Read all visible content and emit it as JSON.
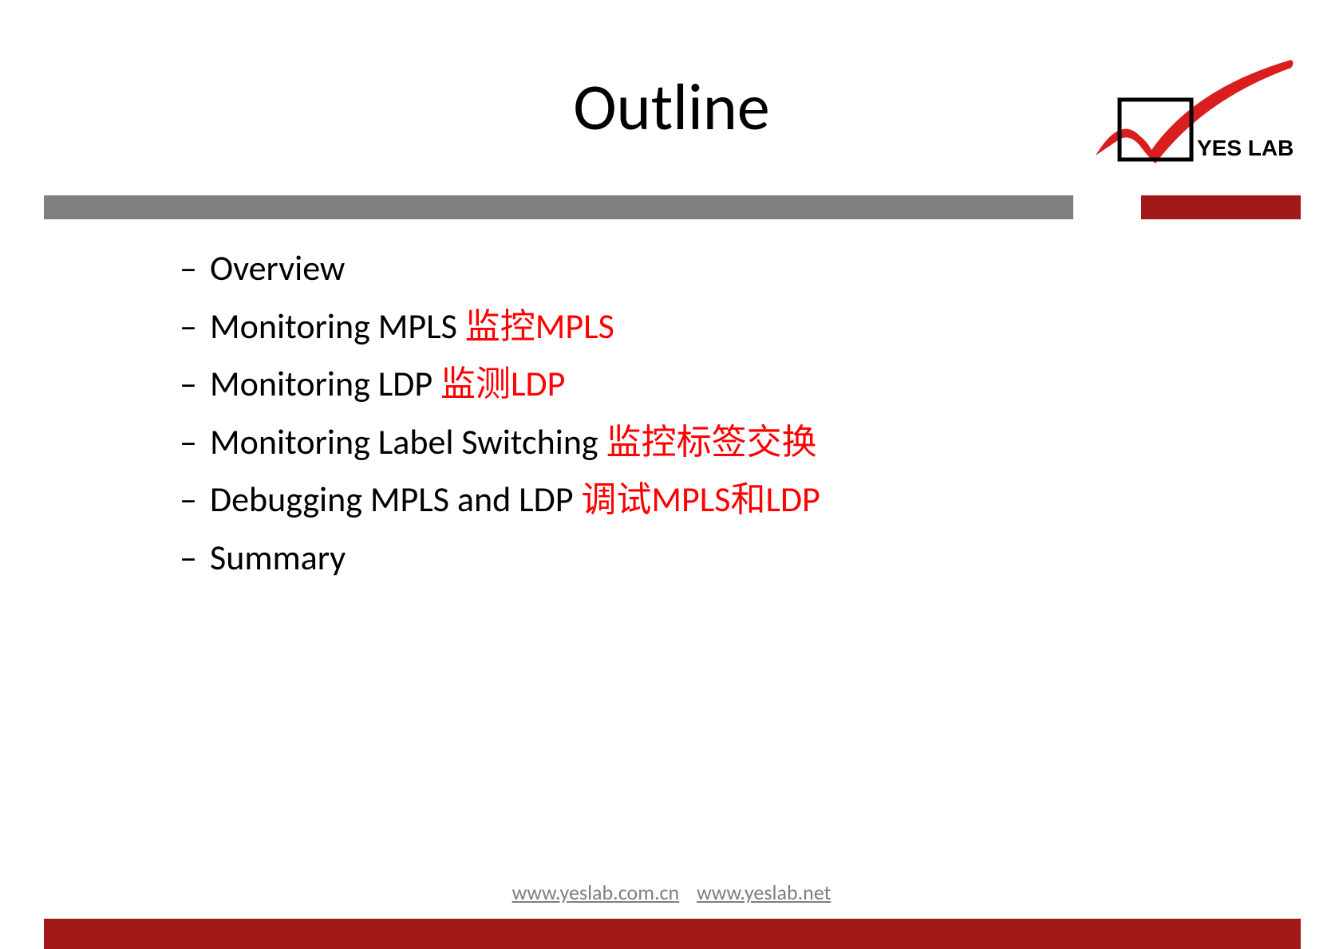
{
  "title": "Outline",
  "logo_text": "YES LAB",
  "items": [
    {
      "en": "Overview",
      "zh": ""
    },
    {
      "en": "Monitoring MPLS",
      "zh": "监控MPLS"
    },
    {
      "en": "Monitoring LDP",
      "zh": "监测LDP"
    },
    {
      "en": "Monitoring Label Switching",
      "zh": "监控标签交换"
    },
    {
      "en": "Debugging MPLS and LDP",
      "zh": "调试MPLS和LDP"
    },
    {
      "en": "Summary",
      "zh": ""
    }
  ],
  "footer": {
    "link1": "www.yeslab.com.cn",
    "link2": "www.yeslab.net"
  }
}
